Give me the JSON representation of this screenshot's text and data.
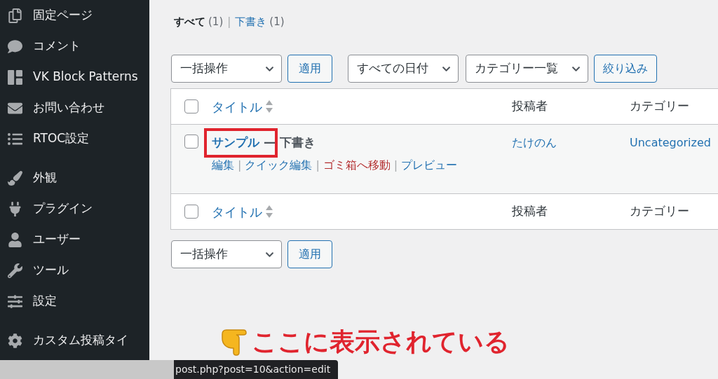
{
  "sidebar": {
    "groups": [
      [
        {
          "label": "固定ページ"
        },
        {
          "label": "コメント"
        },
        {
          "label": "VK Block Patterns"
        },
        {
          "label": "お問い合わせ"
        },
        {
          "label": "RTOC設定"
        }
      ],
      [
        {
          "label": "外観"
        },
        {
          "label": "プラグイン"
        },
        {
          "label": "ユーザー"
        },
        {
          "label": "ツール"
        },
        {
          "label": "設定"
        }
      ],
      [
        {
          "label": "カスタム投稿タイ"
        }
      ]
    ]
  },
  "filters": {
    "separator": "|",
    "items": [
      {
        "label": "すべて",
        "count": "(1)",
        "selected": true
      },
      {
        "label": "下書き",
        "count": "(1)",
        "selected": false
      }
    ]
  },
  "top_toolbar": {
    "bulk_action": "一括操作",
    "apply": "適用",
    "date_filter": "すべての日付",
    "category_filter": "カテゴリー一覧",
    "filter_button": "絞り込み"
  },
  "table": {
    "header": {
      "checked": false,
      "columns": [
        "タイトル",
        "投稿者",
        "カテゴリー"
      ]
    },
    "rows": [
      {
        "checked": false,
        "title": "サンプル",
        "state": "— 下書き",
        "author": "たけのん",
        "category": "Uncategorized",
        "separator": "|",
        "actions": [
          {
            "label": "編集",
            "kind": "link"
          },
          {
            "label": "クイック編集",
            "kind": "link"
          },
          {
            "label": "ゴミ箱へ移動",
            "kind": "danger"
          },
          {
            "label": "プレビュー",
            "kind": "link"
          }
        ]
      }
    ],
    "footer": {
      "checked": false,
      "columns": [
        "タイトル",
        "投稿者",
        "カテゴリー"
      ]
    }
  },
  "bottom_toolbar": {
    "bulk_action": "一括操作",
    "apply": "適用"
  },
  "annotation": {
    "text": "ここに表示されている"
  },
  "status_bar": {
    "url": "post.php?post=10&action=edit"
  }
}
